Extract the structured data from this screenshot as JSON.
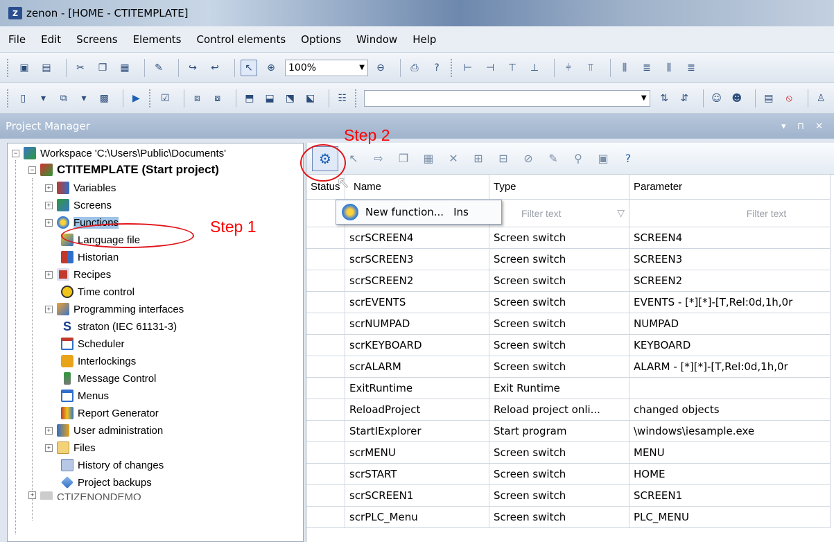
{
  "window": {
    "title": "zenon - [HOME - CTITEMPLATE]",
    "logo": "Z"
  },
  "menu": [
    "File",
    "Edit",
    "Screens",
    "Elements",
    "Control elements",
    "Options",
    "Window",
    "Help"
  ],
  "toolbar": {
    "zoom": "100%"
  },
  "project_manager": {
    "title": "Project Manager",
    "controls": "▾ ⊓ ✕"
  },
  "tree": {
    "workspace": "Workspace 'C:\\Users\\Public\\Documents'",
    "project": "CTITEMPLATE (Start project)",
    "items": [
      "Variables",
      "Screens",
      "Functions",
      "Language file",
      "Historian",
      "Recipes",
      "Time control",
      "Programming interfaces",
      "straton (IEC 61131-3)",
      "Scheduler",
      "Interlockings",
      "Message Control",
      "Menus",
      "Report Generator",
      "User administration",
      "Files",
      "History of changes",
      "Project backups"
    ],
    "next_project": "CTIZENONDEMO"
  },
  "annotations": {
    "step1": "Step 1",
    "step2": "Step 2"
  },
  "grid": {
    "columns": [
      "Status",
      "Name",
      "Type",
      "Parameter"
    ],
    "filter_placeholder": "Filter text",
    "rows": [
      [
        "scrSCREEN4",
        "Screen switch",
        "SCREEN4"
      ],
      [
        "scrSCREEN3",
        "Screen switch",
        "SCREEN3"
      ],
      [
        "scrSCREEN2",
        "Screen switch",
        "SCREEN2"
      ],
      [
        "scrEVENTS",
        "Screen switch",
        "EVENTS - [*][*]-[T,Rel:0d,1h,0r"
      ],
      [
        "scrNUMPAD",
        "Screen switch",
        "NUMPAD"
      ],
      [
        "scrKEYBOARD",
        "Screen switch",
        "KEYBOARD"
      ],
      [
        "scrALARM",
        "Screen switch",
        "ALARM - [*][*]-[T,Rel:0d,1h,0r"
      ],
      [
        "ExitRuntime",
        "Exit Runtime",
        ""
      ],
      [
        "ReloadProject",
        "Reload project onli...",
        "changed objects"
      ],
      [
        "StartIExplorer",
        "Start program",
        "\\windows\\iesample.exe"
      ],
      [
        "scrMENU",
        "Screen switch",
        "MENU"
      ],
      [
        "scrSTART",
        "Screen switch",
        "HOME"
      ],
      [
        "scrSCREEN1",
        "Screen switch",
        "SCREEN1"
      ],
      [
        "scrPLC_Menu",
        "Screen switch",
        "PLC_MENU"
      ]
    ]
  },
  "popup": {
    "label": "New function...",
    "shortcut": "Ins"
  }
}
